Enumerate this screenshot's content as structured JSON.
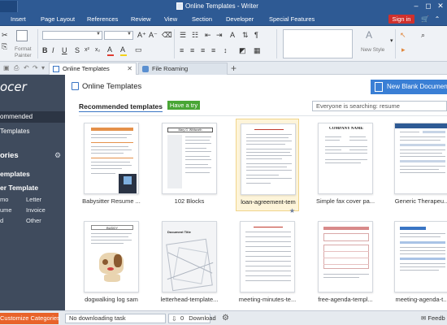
{
  "window": {
    "title": "Online Templates - Writer"
  },
  "menu": {
    "items": [
      "Insert",
      "Page Layout",
      "References",
      "Review",
      "View",
      "Section",
      "Developer",
      "Special Features"
    ],
    "sign_in": "Sign in"
  },
  "ribbon": {
    "format_painter": [
      "Format",
      "Painter"
    ],
    "new_style": "New Style",
    "glyphs": {
      "font_grow": "A⁺",
      "font_shrink": "A⁻",
      "bold": "B",
      "italic": "I",
      "underline": "U",
      "font_color": "A",
      "highlight": "A"
    },
    "colors": {
      "accent_red": "#e03c31",
      "accent_yellow": "#f2d11b"
    }
  },
  "tabs": {
    "items": [
      {
        "label": "Online Templates",
        "active": true
      },
      {
        "label": "File Roaming",
        "active": false
      }
    ]
  },
  "sidebar": {
    "logo": "ocer",
    "nav": [
      "ommended",
      "Templates"
    ],
    "categories_heading": "ories",
    "section1": "emplates",
    "section2": "er Template",
    "cat_col1": [
      "mo",
      "ume",
      "d"
    ],
    "cat_col2": [
      "Letter",
      "Invoice",
      "Other"
    ]
  },
  "content": {
    "title": "Online Templates",
    "new_blank": "New Blank Documen",
    "recommended": "Recommended templates",
    "have_try": "Have a try",
    "search_placeholder": "Everyone is searching: resume",
    "templates": [
      {
        "label": "Babysitter Resume ...",
        "highlight": false
      },
      {
        "label": "102 Blocks",
        "highlight": false
      },
      {
        "label": "loan-agreement-tem",
        "highlight": true
      },
      {
        "label": "Simple fax cover pa...",
        "highlight": false
      },
      {
        "label": "Generic Therapeu...",
        "highlight": false
      },
      {
        "label": "dogwalking log sam",
        "highlight": false
      },
      {
        "label": "letterhead-template...",
        "highlight": false
      },
      {
        "label": "meeting-minutes-te...",
        "highlight": false
      },
      {
        "label": "free-agenda-templ...",
        "highlight": false
      },
      {
        "label": "meeting-agenda-t...",
        "highlight": false
      }
    ],
    "thumb_text": {
      "card2_heading": "Mary G. Whitworth",
      "card4_heading": "COMPANY NAME",
      "card6_heading": "BUDDY",
      "card7_heading": "Document Title"
    }
  },
  "status": {
    "customize": "Customize Categories",
    "download_status": "No downloading task",
    "download_count": "0",
    "download_button": "Download",
    "feedback": "Feedb"
  },
  "colors": {
    "title_bar": "#2e5a94",
    "sidebar": "#3f4b5d",
    "primary_blue": "#3a7fd5",
    "have_try_green": "#49a635",
    "customize_orange": "#e8632a",
    "signin_red": "#d0302c",
    "highlight_card": "#fdf4d9"
  }
}
